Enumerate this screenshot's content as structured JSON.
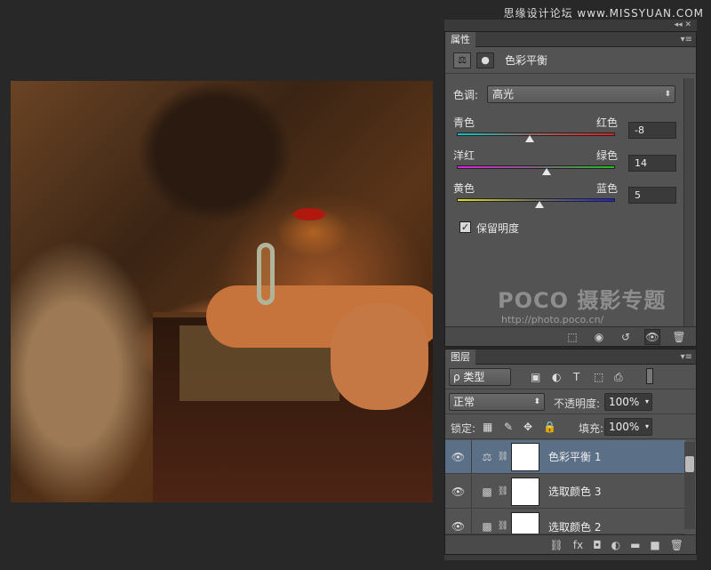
{
  "watermark": "思缘设计论坛 www.MISSYUAN.COM",
  "panel_collapse": "◂◂ ✕",
  "properties": {
    "tab": "属性",
    "menu": "▾≡",
    "title": "色彩平衡",
    "tone_label": "色调:",
    "tone_value": "高光",
    "sliders": [
      {
        "left": "青色",
        "right": "红色",
        "value": "-8",
        "level": -8
      },
      {
        "left": "洋红",
        "right": "绿色",
        "value": "14",
        "level": 14
      },
      {
        "left": "黄色",
        "right": "蓝色",
        "value": "5",
        "level": 5
      }
    ],
    "preserve_label": "保留明度",
    "preserve_checked": "✓",
    "footer_icons": [
      "⬚",
      "◉",
      "↺",
      "👁",
      "🗑"
    ]
  },
  "poco": {
    "logo": "POCO 摄影专题",
    "url": "http://photo.poco.cn/"
  },
  "layers": {
    "tab": "图层",
    "menu": "▾≡",
    "filter": "ρ 类型",
    "filter_icons": [
      "▣",
      "◐",
      "T",
      "⬚",
      "⎙"
    ],
    "blend_mode": "正常",
    "opacity_label": "不透明度:",
    "opacity_value": "100%",
    "lock_label": "锁定:",
    "lock_icons": [
      "▦",
      "✎",
      "✥",
      "🔒"
    ],
    "fill_label": "填充:",
    "fill_value": "100%",
    "rows": [
      {
        "name": "色彩平衡 1",
        "icon": "⚖",
        "eye": "👁"
      },
      {
        "name": "选取颜色 3",
        "icon": "▩",
        "eye": "👁"
      },
      {
        "name": "选取颜色 2",
        "icon": "▩",
        "eye": "👁"
      }
    ],
    "footer_icons": [
      "⛓",
      "fx",
      "◘",
      "◐",
      "▬",
      "■",
      "🗑"
    ]
  }
}
